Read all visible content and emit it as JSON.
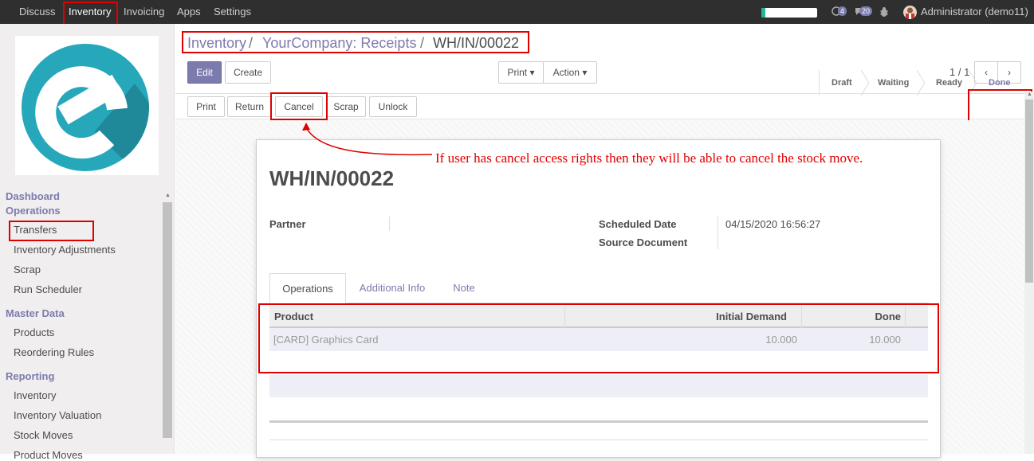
{
  "topbar": {
    "menu": [
      "Discuss",
      "Inventory",
      "Invoicing",
      "Apps",
      "Settings"
    ],
    "chat_count": "4",
    "activity_count": "20",
    "user": "Administrator (demo11)"
  },
  "sidebar": {
    "sections": [
      {
        "heading": "Dashboard",
        "items": []
      },
      {
        "heading": "Operations",
        "items": [
          "Transfers",
          "Inventory Adjustments",
          "Scrap",
          "Run Scheduler"
        ]
      },
      {
        "heading": "Master Data",
        "items": [
          "Products",
          "Reordering Rules"
        ]
      },
      {
        "heading": "Reporting",
        "items": [
          "Inventory",
          "Inventory Valuation",
          "Stock Moves",
          "Product Moves"
        ]
      }
    ]
  },
  "breadcrumb": [
    "Inventory",
    "YourCompany: Receipts",
    "WH/IN/00022"
  ],
  "breadcrumb_sep": "/",
  "toolbar": {
    "edit": "Edit",
    "create": "Create",
    "print": "Print",
    "action": "Action",
    "pager": "1 / 1"
  },
  "statusbar_buttons": [
    "Print",
    "Return",
    "Cancel",
    "Scrap",
    "Unlock"
  ],
  "stages": [
    "Draft",
    "Waiting",
    "Ready",
    "Done"
  ],
  "active_stage": "Done",
  "annotation": "If user has cancel access rights then they will be able to cancel the stock move.",
  "record": {
    "name": "WH/IN/00022",
    "partner_label": "Partner",
    "partner_value": "",
    "scheduled_date_label": "Scheduled Date",
    "scheduled_date": "04/15/2020 16:56:27",
    "source_document_label": "Source Document",
    "source_document": ""
  },
  "tabs": [
    "Operations",
    "Additional Info",
    "Note"
  ],
  "grid": {
    "headers": [
      "Product",
      "Initial Demand",
      "Done"
    ],
    "rows": [
      [
        "[CARD] Graphics Card",
        "10.000",
        "10.000"
      ]
    ]
  },
  "colors": {
    "accent": "#7c7bad",
    "annotation": "#e00000",
    "topbar": "#2f2f2f"
  }
}
